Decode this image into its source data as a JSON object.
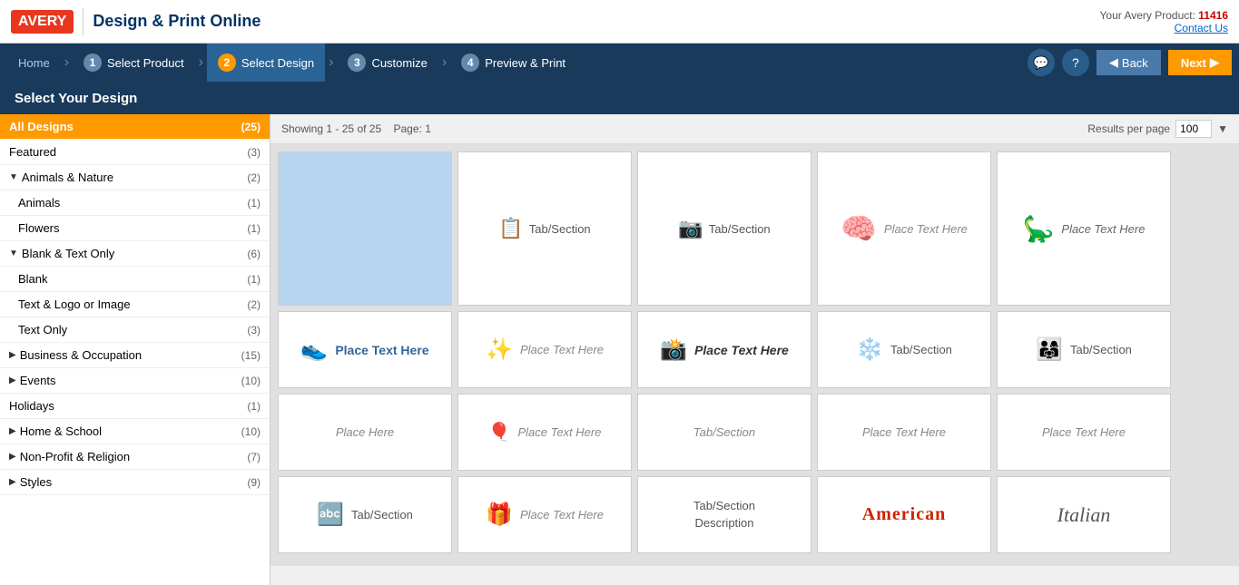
{
  "header": {
    "logo": "AVERY",
    "title": "Design & Print Online",
    "product_label": "Your Avery Product:",
    "product_number": "11416",
    "contact_text": "Contact Us"
  },
  "nav": {
    "home": "Home",
    "steps": [
      {
        "num": "1",
        "label": "Select Product",
        "active": false
      },
      {
        "num": "2",
        "label": "Select Design",
        "active": true
      },
      {
        "num": "3",
        "label": "Customize",
        "active": false
      },
      {
        "num": "4",
        "label": "Preview & Print",
        "active": false
      }
    ],
    "back": "Back",
    "next": "Next"
  },
  "page_title": "Select Your Design",
  "results": {
    "showing_label": "Showing",
    "showing_start": "1",
    "dash": "-",
    "showing_end": "25",
    "of": "of",
    "total": "25",
    "page_label": "Page:",
    "page_num": "1",
    "results_per_page_label": "Results per page",
    "results_per_page_value": "100"
  },
  "sidebar": {
    "items": [
      {
        "id": "all-designs",
        "label": "All Designs",
        "count": "(25)",
        "active": true,
        "indent": 0
      },
      {
        "id": "featured",
        "label": "Featured",
        "count": "(3)",
        "active": false,
        "indent": 0
      },
      {
        "id": "animals-nature",
        "label": "Animals & Nature",
        "count": "(2)",
        "active": false,
        "indent": 0,
        "expandable": true,
        "expanded": true
      },
      {
        "id": "animals",
        "label": "Animals",
        "count": "(1)",
        "active": false,
        "indent": 1
      },
      {
        "id": "flowers",
        "label": "Flowers",
        "count": "(1)",
        "active": false,
        "indent": 1
      },
      {
        "id": "blank-text-only",
        "label": "Blank & Text Only",
        "count": "(6)",
        "active": false,
        "indent": 0,
        "expandable": true,
        "expanded": true
      },
      {
        "id": "blank",
        "label": "Blank",
        "count": "(1)",
        "active": false,
        "indent": 1
      },
      {
        "id": "text-logo-image",
        "label": "Text & Logo or Image",
        "count": "(2)",
        "active": false,
        "indent": 1
      },
      {
        "id": "text-only",
        "label": "Text Only",
        "count": "(3)",
        "active": false,
        "indent": 1
      },
      {
        "id": "business-occupation",
        "label": "Business & Occupation",
        "count": "(15)",
        "active": false,
        "indent": 0,
        "expandable": true,
        "expanded": false
      },
      {
        "id": "events",
        "label": "Events",
        "count": "(10)",
        "active": false,
        "indent": 0,
        "expandable": true,
        "expanded": false
      },
      {
        "id": "holidays",
        "label": "Holidays",
        "count": "(1)",
        "active": false,
        "indent": 0
      },
      {
        "id": "home-school",
        "label": "Home & School",
        "count": "(10)",
        "active": false,
        "indent": 0,
        "expandable": true,
        "expanded": false
      },
      {
        "id": "non-profit-religion",
        "label": "Non-Profit & Religion",
        "count": "(7)",
        "active": false,
        "indent": 0,
        "expandable": true,
        "expanded": false
      },
      {
        "id": "styles",
        "label": "Styles",
        "count": "(9)",
        "active": false,
        "indent": 0,
        "expandable": true,
        "expanded": false
      }
    ]
  },
  "design_cards": {
    "row1": [
      {
        "id": "blue-placeholder",
        "type": "blue",
        "icon": "",
        "text": ""
      },
      {
        "id": "tab-section-1",
        "type": "normal",
        "icon": "📋",
        "text": "Tab/Section",
        "text_style": "tab"
      },
      {
        "id": "tab-section-2",
        "type": "normal",
        "icon": "📷",
        "text": "Tab/Section",
        "text_style": "tab"
      },
      {
        "id": "place-text-brain",
        "type": "normal",
        "icon": "🧠",
        "text": "Place Text Here",
        "text_style": "place"
      },
      {
        "id": "place-text-dino",
        "type": "normal",
        "icon": "🦕",
        "text": "Place Text Here",
        "text_style": "place"
      }
    ],
    "row2": [
      {
        "id": "place-text-shoe",
        "type": "normal",
        "icon": "👟",
        "text": "Place Text Here",
        "text_style": "bold-blue",
        "icon_color": "shoe"
      },
      {
        "id": "place-text-sun",
        "type": "normal",
        "icon": "✨",
        "text": "Place Text Here",
        "text_style": "place",
        "icon_color": "sun"
      },
      {
        "id": "place-text-camera",
        "type": "normal",
        "icon": "📸",
        "text": "Place Text Here",
        "text_style": "bold-dark",
        "icon_color": "camera"
      },
      {
        "id": "tab-section-snow",
        "type": "normal",
        "icon": "❄️",
        "text": "Tab/Section",
        "text_style": "tab",
        "icon_color": "snow"
      },
      {
        "id": "tab-section-kids",
        "type": "normal",
        "icon": "👨‍👩‍👧",
        "text": "Tab/Section",
        "text_style": "tab",
        "icon_color": "kids"
      }
    ],
    "row3": [
      {
        "id": "tab-section-abc",
        "type": "normal",
        "icon": "🔤",
        "text": "Tab/Section",
        "text_style": "tab",
        "icon_color": "abc"
      },
      {
        "id": "place-text-gift",
        "type": "normal",
        "icon": "🎁",
        "text": "Place Text Here",
        "text_style": "place",
        "icon_color": "gift"
      },
      {
        "id": "tab-section-desc",
        "type": "normal",
        "icon": "",
        "text": "Tab/Section\nDescription",
        "text_style": "tab"
      },
      {
        "id": "american",
        "type": "normal",
        "icon": "",
        "text": "American",
        "text_style": "american"
      },
      {
        "id": "italian",
        "type": "normal",
        "icon": "",
        "text": "Italian",
        "text_style": "italian"
      }
    ]
  }
}
